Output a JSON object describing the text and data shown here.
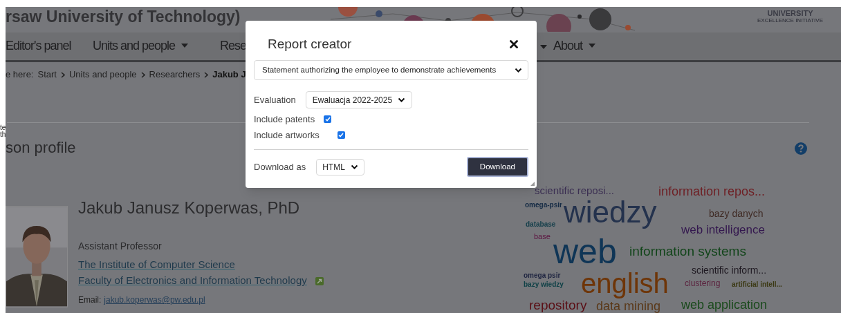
{
  "header": {
    "title": "rsaw University of Technology)",
    "badge_lines": [
      "UNIVERSITY",
      "EXCELLENCE INITIATIVE"
    ]
  },
  "side_fragments": [
    "te",
    "th"
  ],
  "nav": {
    "items": [
      {
        "kind": "text",
        "label": "Editor's panel",
        "dropdown": false
      },
      {
        "kind": "text",
        "label": "Units and people",
        "dropdown": true
      },
      {
        "kind": "text",
        "label": "Rese",
        "dropdown": false
      },
      {
        "kind": "caret"
      },
      {
        "kind": "text",
        "label": "About",
        "dropdown": true
      }
    ]
  },
  "breadcrumb": {
    "prefix": "e here:",
    "items": [
      {
        "label": "Start",
        "current": false
      },
      {
        "label": "Units and people",
        "current": false
      },
      {
        "label": "Researchers",
        "current": false
      },
      {
        "label": "Jakub J",
        "current": true
      }
    ]
  },
  "profile": {
    "heading": "son profile",
    "name": "Jakub Janusz Koperwas, PhD",
    "position": "Assistant Professor",
    "links": [
      {
        "label": "The Institute of Computer Science",
        "external": false
      },
      {
        "label": "Faculty of Electronics and Information Technology",
        "external": true
      }
    ],
    "email_label": "Email:",
    "email": "jakub.koperwas@pw.edu.pl"
  },
  "word_cloud": [
    {
      "text": "scientific reposi...",
      "color": "#3b2f52"
    },
    {
      "text": "information repos...",
      "color": "#6e1f24"
    },
    {
      "text": "omega-psir",
      "color": "#142a44"
    },
    {
      "text": "wiedzy",
      "color": "#24324d"
    },
    {
      "text": "bazy danych",
      "color": "#3f2a24"
    },
    {
      "text": "database",
      "color": "#133e4a"
    },
    {
      "text": "web intelligence",
      "color": "#33174e"
    },
    {
      "text": "base",
      "color": "#5c1440"
    },
    {
      "text": "web",
      "color": "#0f3556"
    },
    {
      "text": "information systems",
      "color": "#12451a"
    },
    {
      "text": "scientific inform...",
      "color": "#1f1a22"
    },
    {
      "text": "omega psir",
      "color": "#1e2440"
    },
    {
      "text": "bazy wiedzy",
      "color": "#0e4046"
    },
    {
      "text": "english",
      "color": "#6e3508"
    },
    {
      "text": "clustering",
      "color": "#5a1f3c"
    },
    {
      "text": "artificial intell...",
      "color": "#3a3812"
    },
    {
      "text": "repository",
      "color": "#5a0f16"
    },
    {
      "text": "data mining",
      "color": "#5a3818"
    },
    {
      "text": "web application",
      "color": "#1a4a1c"
    }
  ],
  "modal": {
    "title": "Report creator",
    "report_select": "Statement authorizing the employee to demonstrate achievements",
    "evaluation": {
      "label": "Evaluation",
      "value": "Ewaluacja 2022-2025"
    },
    "options": [
      {
        "label": "Include patents",
        "checked": true
      },
      {
        "label": "Include artworks",
        "checked": true
      }
    ],
    "download_as": {
      "label": "Download as",
      "value": "HTML"
    },
    "button": "Download"
  }
}
